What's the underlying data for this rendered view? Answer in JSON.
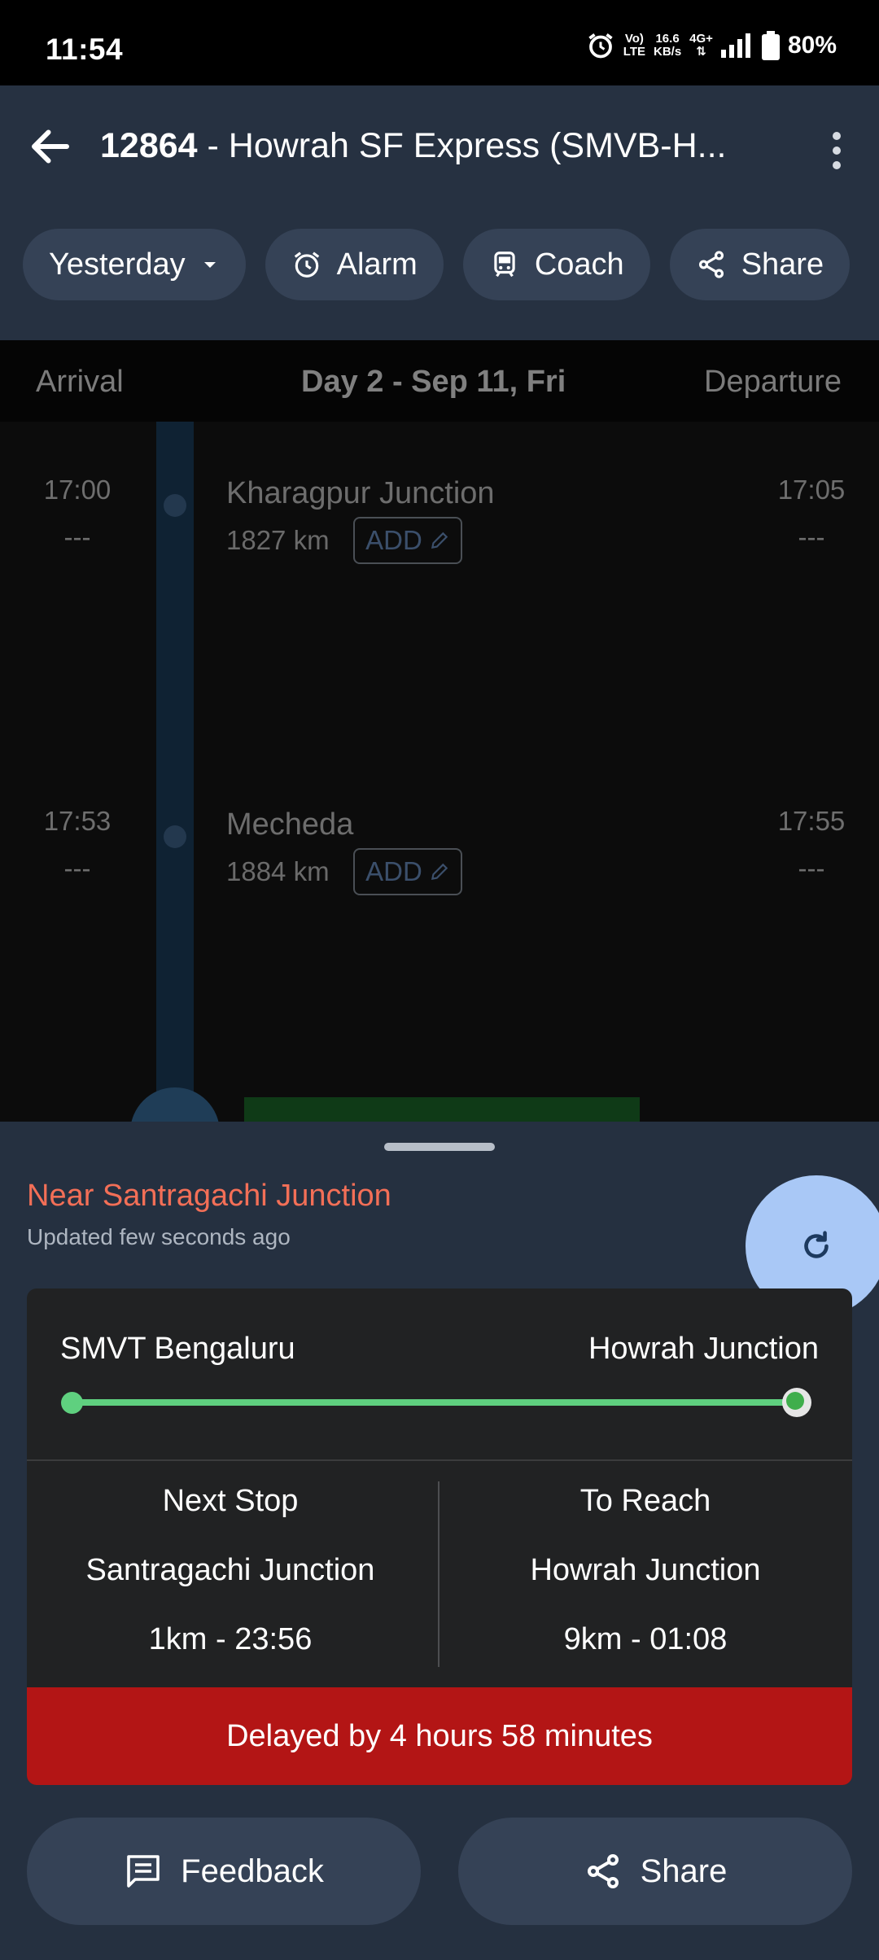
{
  "status_bar": {
    "time": "11:54",
    "network_top": "Vo)",
    "network_bottom": "LTE",
    "speed_top": "16.6",
    "speed_bottom": "KB/s",
    "signal": "4G+",
    "battery": "80%"
  },
  "header": {
    "train_number": "12864",
    "title_rest": " - Howrah SF Express (SMVB-H..."
  },
  "chips": {
    "day": "Yesterday",
    "alarm": "Alarm",
    "coach": "Coach",
    "share": "Share"
  },
  "timeline_header": {
    "arrival": "Arrival",
    "day": "Day 2 - Sep 11, Fri",
    "departure": "Departure"
  },
  "stations": [
    {
      "arrival": "17:00",
      "arrival_actual": "---",
      "name": "Kharagpur Junction",
      "distance": "1827 km",
      "add_label": "ADD",
      "departure": "17:05",
      "departure_actual": "---"
    },
    {
      "arrival": "17:53",
      "arrival_actual": "---",
      "name": "Mecheda",
      "distance": "1884 km",
      "add_label": "ADD",
      "departure": "17:55",
      "departure_actual": "---"
    }
  ],
  "live_status": {
    "location": "Near Santragachi Junction",
    "updated": "Updated few seconds ago",
    "from": "SMVT Bengaluru",
    "to": "Howrah Junction",
    "progress": 0.99,
    "next_stop_label": "Next Stop",
    "next_stop_name": "Santragachi Junction",
    "next_stop_eta": "1km - 23:56",
    "to_reach_label": "To Reach",
    "to_reach_name": "Howrah Junction",
    "to_reach_eta": "9km - 01:08",
    "delay": "Delayed by 4 hours 58 minutes"
  },
  "bottom_actions": {
    "feedback": "Feedback",
    "share": "Share"
  },
  "colors": {
    "appbar": "#263141",
    "chip": "#354256",
    "alert": "#f36f57",
    "progress": "#5fd07f",
    "delay_banner": "#b31515",
    "refresh": "#a9c8f6"
  }
}
